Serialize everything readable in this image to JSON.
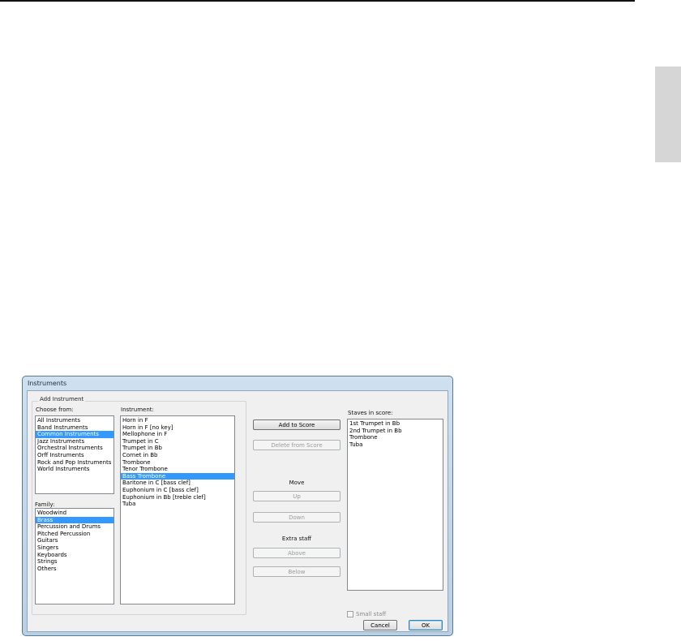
{
  "dialog": {
    "title": "Instruments",
    "group_title": "Add Instrument",
    "choose_from": {
      "label": "Choose from:",
      "items": [
        "All Instruments",
        "Band Instruments",
        "Common Instruments",
        "Jazz Instruments",
        "Orchestral Instruments",
        "Orff Instruments",
        "Rock and Pop Instruments",
        "World Instruments"
      ],
      "selected": "Common Instruments"
    },
    "family": {
      "label": "Family:",
      "items": [
        "Woodwind",
        "Brass",
        "Percussion and Drums",
        "Pitched Percussion",
        "Guitars",
        "Singers",
        "Keyboards",
        "Strings",
        "Others"
      ],
      "selected": "Brass"
    },
    "instrument": {
      "label": "Instrument:",
      "items": [
        "Horn in F",
        "Horn in F [no key]",
        "Mellophone in F",
        "Trumpet in C",
        "Trumpet in Bb",
        "Cornet in Bb",
        "Trombone",
        "Tenor Trombone",
        "Bass Trombone",
        "Baritone in C [bass clef]",
        "Euphonium in C [bass clef]",
        "Euphonium in Bb [treble clef]",
        "Tuba"
      ],
      "selected": "Bass Trombone"
    },
    "buttons": {
      "add_to_score": "Add to Score",
      "delete_from_score": "Delete from Score",
      "move_label": "Move",
      "up": "Up",
      "down": "Down",
      "extra_staff_label": "Extra staff",
      "above": "Above",
      "below": "Below",
      "cancel": "Cancel",
      "ok": "OK"
    },
    "staves": {
      "label": "Staves in score:",
      "items": [
        "1st Trumpet in Bb",
        "2nd Trumpet in Bb",
        "Trombone",
        "Tuba"
      ]
    },
    "small_staff": {
      "label": "Small staff",
      "checked": false
    }
  }
}
